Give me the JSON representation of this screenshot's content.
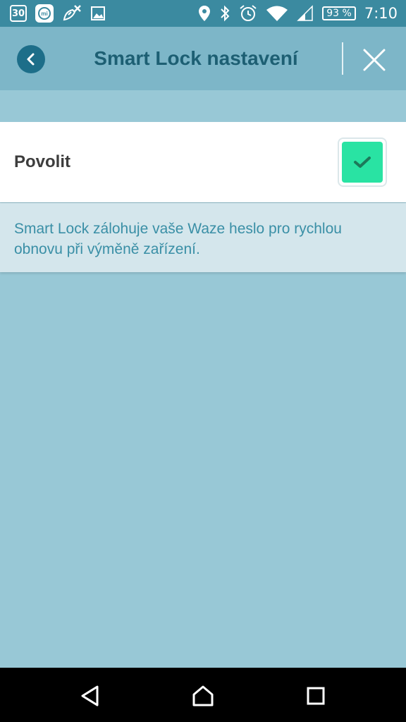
{
  "status_bar": {
    "calendar_date": "30",
    "mi_label": "mi",
    "battery_level": "93 %",
    "time": "7:10",
    "icons": [
      "calendar-icon",
      "mi-fit-icon",
      "satellite-off-icon",
      "image-icon",
      "location-icon",
      "bluetooth-icon",
      "alarm-icon",
      "wifi-icon",
      "signal-icon",
      "battery-icon"
    ]
  },
  "header": {
    "title": "Smart Lock nastavení",
    "back_icon": "chevron-left-icon",
    "close_icon": "close-icon"
  },
  "setting": {
    "label": "Povolit",
    "checked": true,
    "description": "Smart Lock zálohuje vaše Waze heslo pro rychlou obnovu při výměně zařízení."
  },
  "colors": {
    "status_bar": "#3b8aa0",
    "header": "#7db6c8",
    "background": "#98c8d6",
    "title": "#1d5f73",
    "checkbox": "#29e3a3",
    "description_text": "#3a8fa6"
  },
  "nav_bar": {
    "icons": [
      "back-triangle-icon",
      "home-icon",
      "recents-icon"
    ]
  }
}
